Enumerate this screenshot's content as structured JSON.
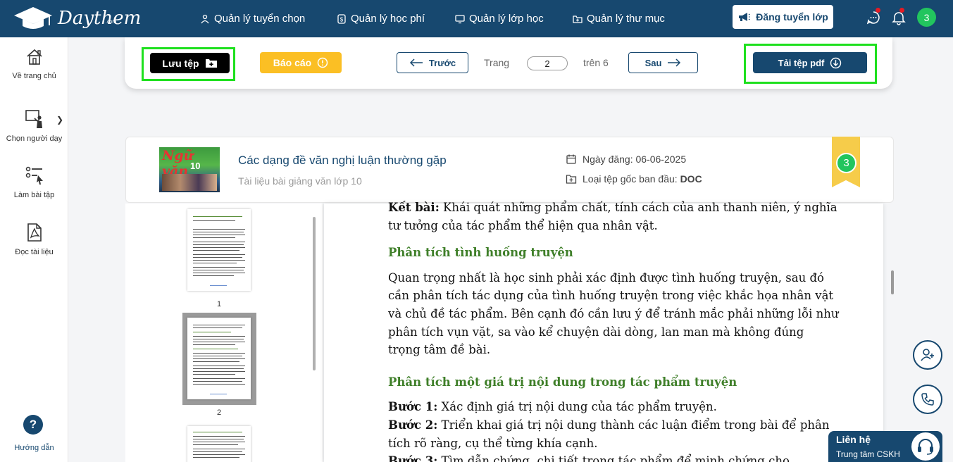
{
  "header": {
    "logo_text": "Daythem",
    "logo_sub": ".com",
    "nav": [
      {
        "label": "Quản lý tuyển chọn",
        "icon": "users-icon"
      },
      {
        "label": "Quản lý học phí",
        "icon": "dollar-icon"
      },
      {
        "label": "Quản lý lớp học",
        "icon": "monitor-icon"
      },
      {
        "label": "Quản lý thư mục",
        "icon": "folder-icon"
      }
    ],
    "post_button": "Đăng tuyển lớp",
    "avatar": "3"
  },
  "sidebar": {
    "items": [
      {
        "label": "Về trang chủ",
        "icon": "home-icon"
      },
      {
        "label": "Chọn người dạy",
        "icon": "teacher-icon"
      },
      {
        "label": "Làm bài tập",
        "icon": "exercise-icon"
      },
      {
        "label": "Đọc tài liệu",
        "icon": "pdf-icon"
      }
    ],
    "help_symbol": "?",
    "help_label": "Hướng dẫn"
  },
  "toolbar": {
    "save": "Lưu tệp",
    "report": "Báo cáo",
    "prev": "Trước",
    "page_label": "Trang",
    "current_page": "2",
    "of_label": "trên 6",
    "next": "Sau",
    "download": "Tải tệp pdf"
  },
  "document": {
    "cover_title": "Ngữ văn",
    "cover_grade": "10",
    "title": "Các dạng đề văn nghị luận thường gặp",
    "subtitle": "Tài liệu bài giảng văn lớp 10",
    "date_label": "Ngày đăng: 06-06-2025",
    "type_label": "Loại tệp gốc ban đầu: ",
    "type_value": "DOC",
    "badge": "3"
  },
  "thumbnails": [
    "1",
    "2"
  ],
  "content": {
    "p1_bold": "Kết bài:",
    "p1_text": " Khái quát những phẩm chất, tính cách của anh thanh niên, ý nghĩa tư tưởng của tác phẩm thể hiện qua nhân vật.",
    "h1": "Phân tích tình huống truyện",
    "p2": "Quan trọng nhất là học sinh phải xác định được tình huống truyện, sau đó cần phân tích tác dụng của tình huống truyện trong việc khắc họa nhân vật và chủ đề tác phẩm. Bên cạnh đó cần lưu ý để tránh mắc phải những lỗi như phân tích vụn vặt, sa vào kể chuyện dài dòng, lan man mà không đúng trọng tâm đề bài.",
    "h2": "Phân tích một giá trị nội dung trong tác phẩm truyện",
    "s1_bold": "Bước 1:",
    "s1_text": " Xác định giá trị nội dung của tác phẩm truyện.",
    "s2_bold": "Bước 2:",
    "s2_text": " Triển khai giá trị nội dung thành các luận điểm trong bài để phân tích rõ ràng, cụ thể từng khía cạnh.",
    "s3_bold": "Bước 3:",
    "s3_text": " Tìm dẫn chứng, chi tiết trong tác phẩm để minh chứng cho"
  },
  "contact": {
    "title": "Liên hệ",
    "subtitle": "Trung tâm CSKH"
  },
  "colors": {
    "primary": "#17486f",
    "highlight": "#1ee01e",
    "report": "#fbbf24",
    "heading_green": "#3f7f29"
  }
}
